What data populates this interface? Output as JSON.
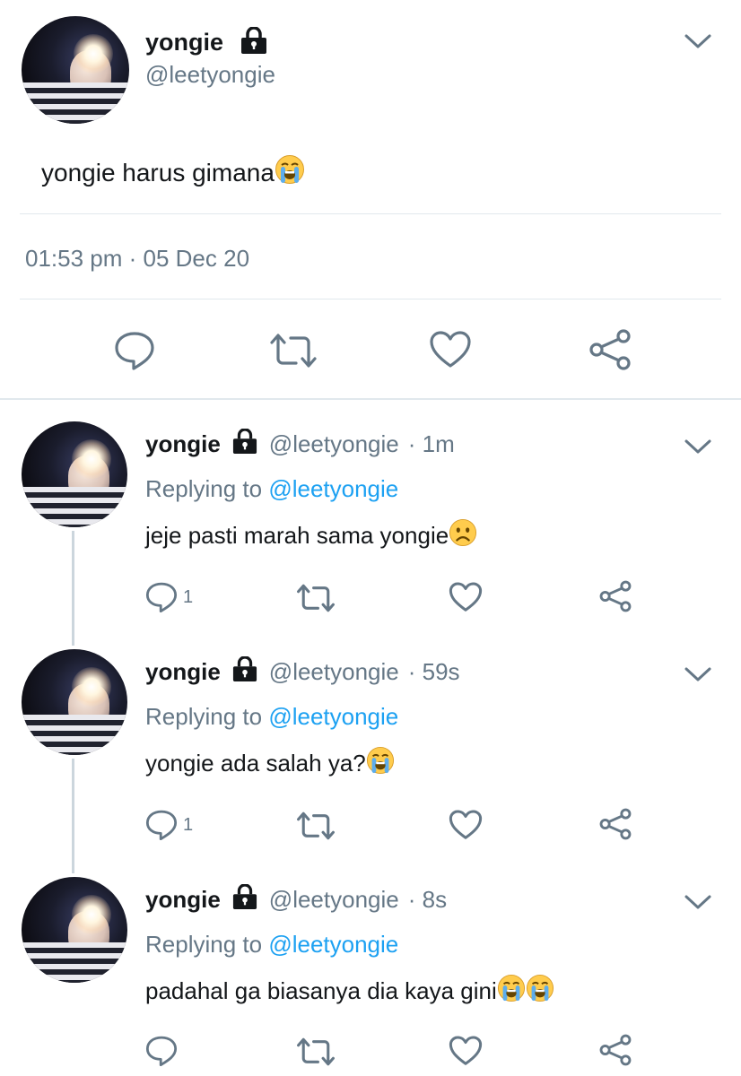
{
  "main_tweet": {
    "name": "yongie",
    "handle": "@leetyongie",
    "text": "yongie harus gimana",
    "emojis": [
      "loudly-crying-face"
    ],
    "timestamp": "01:53 pm · 05 Dec 20"
  },
  "replies": [
    {
      "name": "yongie",
      "handle": "@leetyongie",
      "time": "· 1m",
      "replying_prefix": "Replying to",
      "replying_to": "@leetyongie",
      "text": "jeje pasti marah sama yongie",
      "emojis": [
        "frowning-face"
      ],
      "reply_count": "1"
    },
    {
      "name": "yongie",
      "handle": "@leetyongie",
      "time": "· 59s",
      "replying_prefix": "Replying to",
      "replying_to": "@leetyongie",
      "text": "yongie ada salah ya?",
      "emojis": [
        "loudly-crying-face"
      ],
      "reply_count": "1"
    },
    {
      "name": "yongie",
      "handle": "@leetyongie",
      "time": "· 8s",
      "replying_prefix": "Replying to",
      "replying_to": "@leetyongie",
      "text": "padahal ga biasanya dia kaya gini",
      "emojis": [
        "loudly-crying-face",
        "loudly-crying-face"
      ],
      "reply_count": ""
    }
  ],
  "colors": {
    "text": "#14171a",
    "secondary": "#657786",
    "link": "#1da1f2",
    "icon": "#657786",
    "divider": "#e1e8ed"
  }
}
